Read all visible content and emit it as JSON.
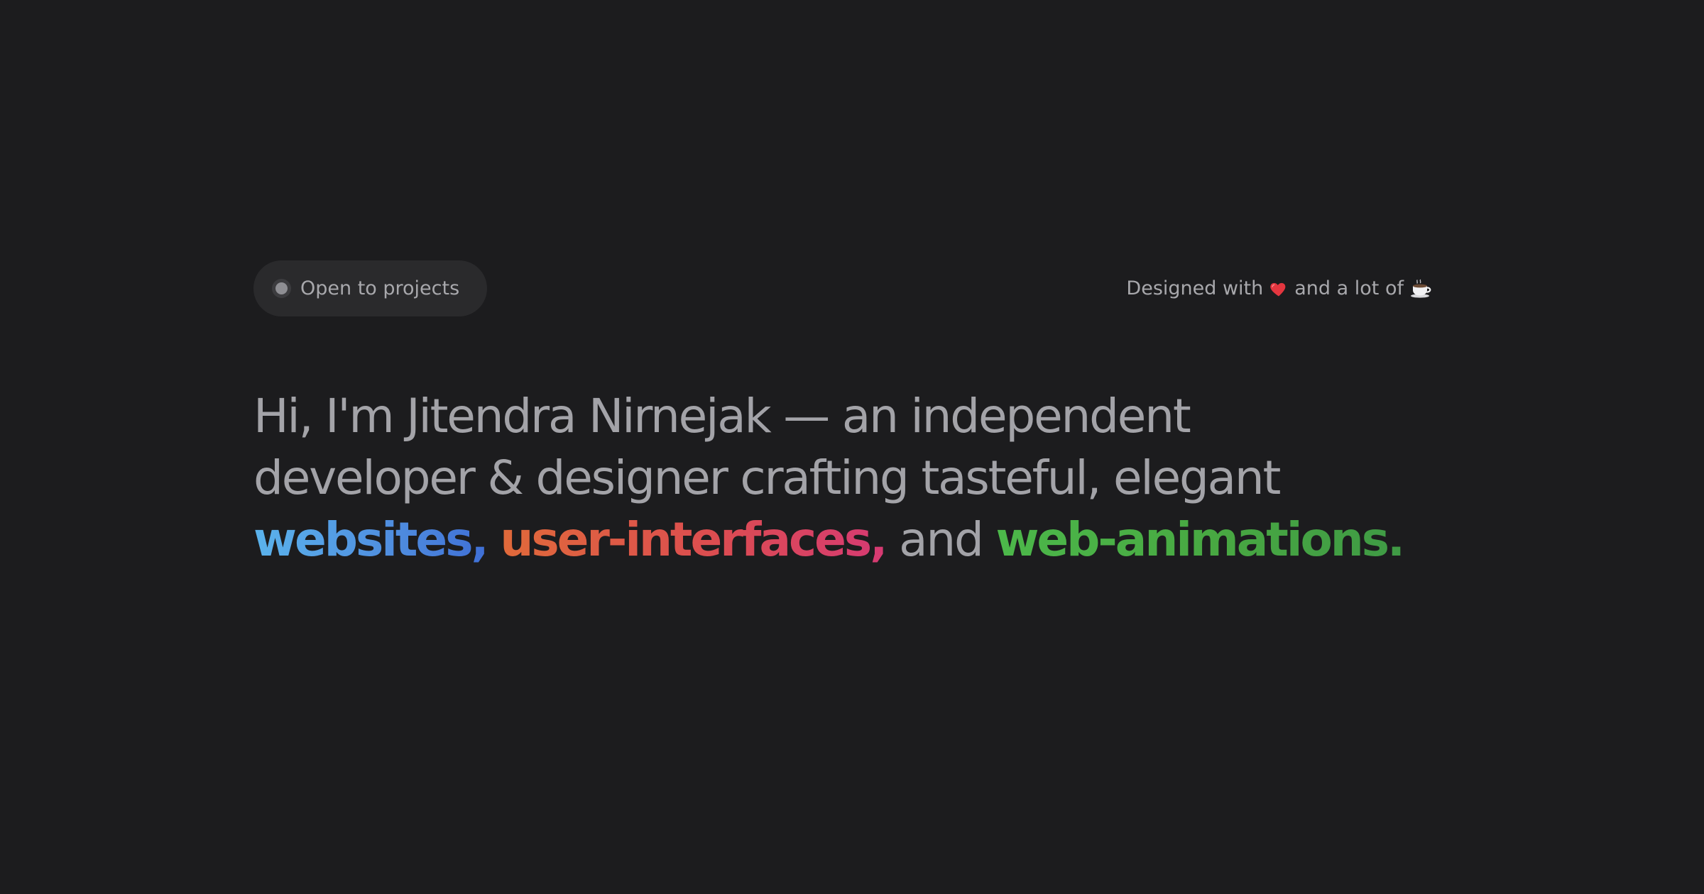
{
  "status_pill": {
    "label": "Open to projects"
  },
  "credit": {
    "prefix": "Designed with",
    "heart_icon": "heart-icon",
    "middle": "and a lot of",
    "coffee_icon": "coffee-icon"
  },
  "headline": {
    "line1": "Hi, I'm Jitendra Nirnejak — an independent",
    "line2": "developer & designer crafting tasteful, elegant",
    "highlight_websites": "websites,",
    "highlight_ui": "user-interfaces,",
    "connector": "and",
    "highlight_animations": "web-animations."
  },
  "colors": {
    "background": "#1c1c1e",
    "pill_background": "#2a2a2c",
    "text_muted": "#a3a3a8",
    "websites_gradient": [
      "#5bb3ec",
      "#3f6fd6"
    ],
    "ui_gradient": [
      "#e06a3a",
      "#d63a73"
    ],
    "animations_gradient": [
      "#4cb84a",
      "#3f9a45"
    ]
  }
}
